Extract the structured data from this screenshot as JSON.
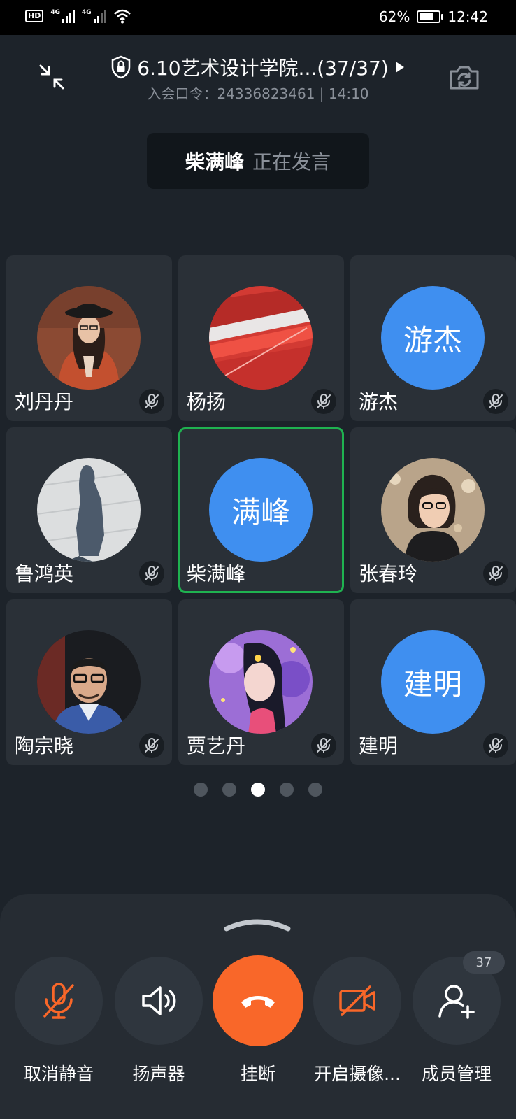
{
  "status_bar": {
    "battery": "62%",
    "time": "12:42",
    "hd_label": "HD",
    "net1": "4G",
    "net2": "4G"
  },
  "meeting": {
    "title": "6.10艺术设计学院...(37/37)",
    "subtitle": "入会口令：24336823461 | 14:10"
  },
  "speaker_banner": {
    "name": "柴满峰",
    "status": "正在发言"
  },
  "participants": [
    {
      "name": "刘丹丹",
      "avatar_type": "photo",
      "muted": true
    },
    {
      "name": "杨扬",
      "avatar_type": "photo",
      "muted": true
    },
    {
      "name": "游杰",
      "avatar_type": "text",
      "avatar_text": "游杰",
      "muted": true
    },
    {
      "name": "鲁鸿英",
      "avatar_type": "photo",
      "muted": true
    },
    {
      "name": "柴满峰",
      "avatar_type": "text",
      "avatar_text": "满峰",
      "muted": false,
      "speaking": true
    },
    {
      "name": "张春玲",
      "avatar_type": "photo",
      "muted": true
    },
    {
      "name": "陶宗晓",
      "avatar_type": "photo",
      "muted": true
    },
    {
      "name": "贾艺丹",
      "avatar_type": "photo",
      "muted": true
    },
    {
      "name": "建明",
      "avatar_type": "text",
      "avatar_text": "建明",
      "muted": true
    }
  ],
  "pagination": {
    "total": 5,
    "current": 3
  },
  "controls": {
    "unmute": "取消静音",
    "speaker": "扬声器",
    "hangup": "挂断",
    "camera": "开启摄像...",
    "members": "成员管理",
    "member_count": "37"
  },
  "colors": {
    "accent": "#3f8ff0",
    "hangup": "#f96729",
    "speaking_border": "#1fb250",
    "muted_icon": "#f96729"
  }
}
